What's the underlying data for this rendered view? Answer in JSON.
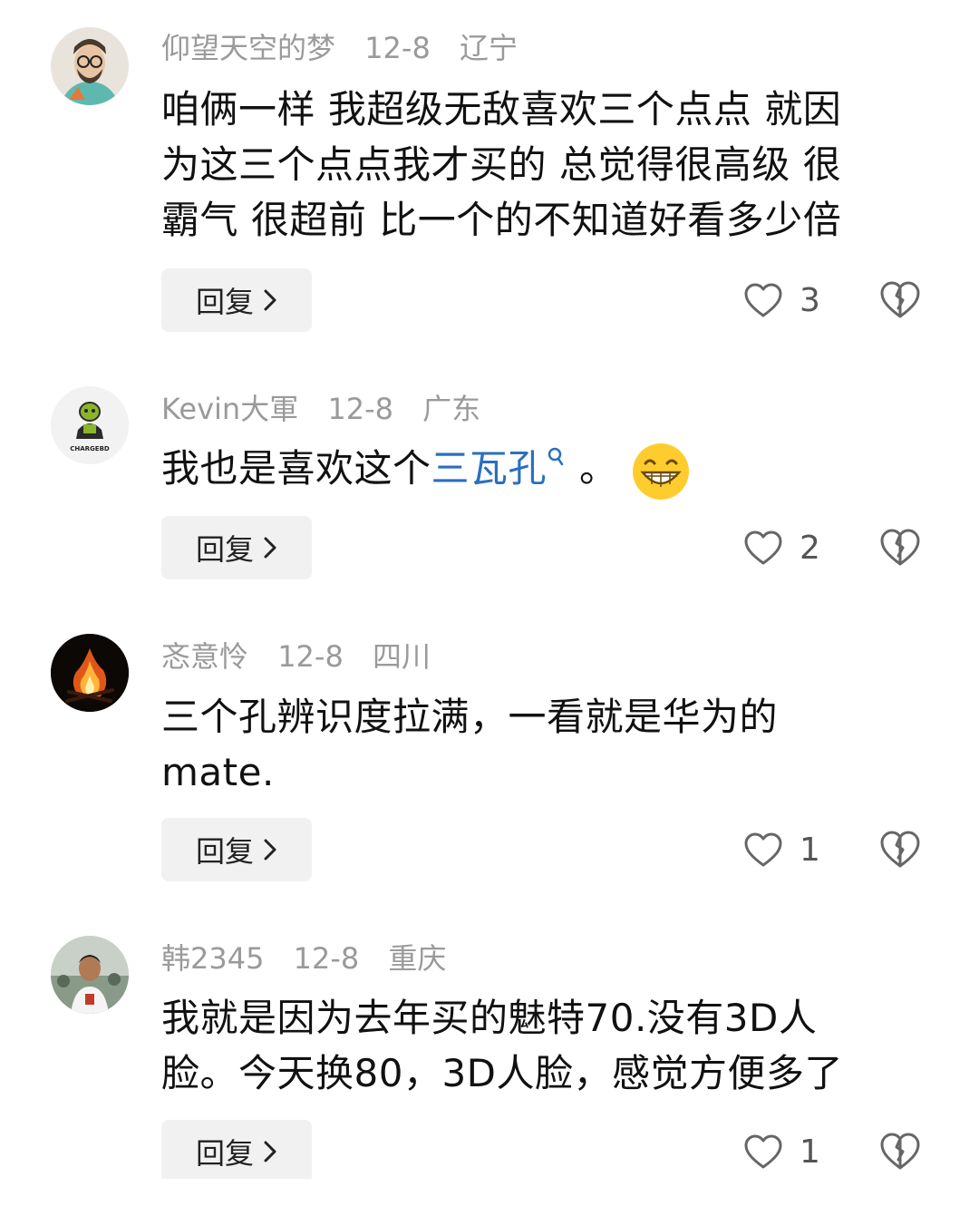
{
  "comments": [
    {
      "user": "仰望天空的梦",
      "date": "12-8",
      "location": "辽宁",
      "lines": [
        "咱俩一样 我超级无敌喜欢三个点点 就因",
        "为这三个点点我才买的 总觉得很高级 很",
        "霸气 很超前 比一个的不知道好看多少倍"
      ],
      "reply_label": "回复",
      "likes": "3"
    },
    {
      "user": "Kevin大軍",
      "date": "12-8",
      "location": "广东",
      "text_before": "我也是喜欢这个",
      "link_text": "三瓦孔",
      "text_after": "。",
      "reply_label": "回复",
      "likes": "2",
      "avatar_label": "CHARGEBD"
    },
    {
      "user": "忞意怜",
      "date": "12-8",
      "location": "四川",
      "lines": [
        "三个孔辨识度拉满，一看就是华为的",
        "mate."
      ],
      "reply_label": "回复",
      "likes": "1"
    },
    {
      "user": "韩2345",
      "date": "12-8",
      "location": "重庆",
      "lines": [
        "我就是因为去年买的魅特70.没有3D人",
        "脸。今天换80，3D人脸，感觉方便多了"
      ],
      "reply_label": "回复",
      "likes": "1"
    }
  ],
  "icons": {
    "like": "heart-outline-icon",
    "dislike": "broken-heart-icon",
    "reply_chevron": "chevron-right-icon",
    "emoji": "grinning-face-emoji",
    "search_mark": "search-icon"
  },
  "colors": {
    "link": "#2a6fc0",
    "meta": "#9a9a9a",
    "reply_bg": "#f1f1f1"
  }
}
